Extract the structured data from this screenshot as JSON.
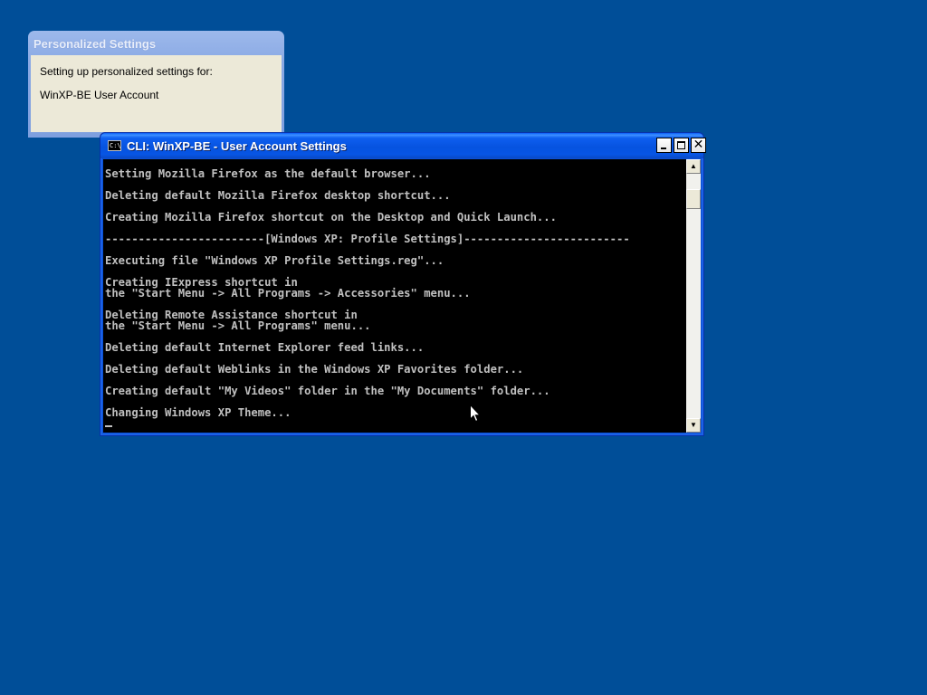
{
  "personalized_settings": {
    "title": "Personalized Settings",
    "line1": "Setting up personalized settings for:",
    "line2": "WinXP-BE User Account"
  },
  "cli_window": {
    "icon_text": "C:\\",
    "title": "CLI: WinXP-BE - User Account Settings",
    "buttons": {
      "minimize": "minimize",
      "maximize": "maximize",
      "close": "close"
    },
    "lines": [
      "Setting Mozilla Firefox as the default browser...",
      "",
      "Deleting default Mozilla Firefox desktop shortcut...",
      "",
      "Creating Mozilla Firefox shortcut on the Desktop and Quick Launch...",
      "",
      "------------------------[Windows XP: Profile Settings]-------------------------",
      "",
      "Executing file \"Windows XP Profile Settings.reg\"...",
      "",
      "Creating IExpress shortcut in",
      "the \"Start Menu -> All Programs -> Accessories\" menu...",
      "",
      "Deleting Remote Assistance shortcut in",
      "the \"Start Menu -> All Programs\" menu...",
      "",
      "Deleting default Internet Explorer feed links...",
      "",
      "Deleting default Weblinks in the Windows XP Favorites folder...",
      "",
      "Creating default \"My Videos\" folder in the \"My Documents\" folder...",
      "",
      "Changing Windows XP Theme..."
    ],
    "scrollbar": {
      "up_icon": "▲",
      "down_icon": "▼",
      "position": 0.1
    }
  },
  "colors": {
    "desktop": "#004E98",
    "console_bg": "#000000",
    "console_text": "#C0C0C0"
  }
}
